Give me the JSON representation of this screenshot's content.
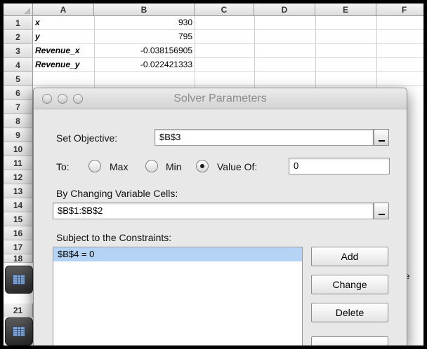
{
  "spreadsheet": {
    "columns": [
      "A",
      "B",
      "C",
      "D",
      "E",
      "F"
    ],
    "rows": [
      "1",
      "2",
      "3",
      "4",
      "5",
      "6",
      "7",
      "8",
      "9",
      "10",
      "11",
      "12",
      "13",
      "14",
      "15",
      "16",
      "17",
      "18"
    ],
    "cells": [
      {
        "label": "x",
        "value": "930"
      },
      {
        "label": "y",
        "value": "795"
      },
      {
        "label": "Revenue_x",
        "value": "-0.038156905"
      },
      {
        "label": "Revenue_y",
        "value": "-0.022421333"
      }
    ],
    "lower_row": "21",
    "peek_text": "ee"
  },
  "dialog": {
    "title": "Solver Parameters",
    "set_objective": {
      "label": "Set Objective:",
      "value": "$B$3"
    },
    "to": {
      "label": "To:",
      "options": [
        "Max",
        "Min",
        "Value Of:"
      ],
      "selected": "Value Of:",
      "value_of": "0"
    },
    "changing_cells": {
      "label": "By Changing Variable Cells:",
      "value": "$B$1:$B$2"
    },
    "constraints": {
      "label": "Subject to the Constraints:",
      "items": [
        "$B$4 = 0"
      ]
    },
    "buttons": {
      "add": "Add",
      "change": "Change",
      "delete": "Delete"
    }
  }
}
